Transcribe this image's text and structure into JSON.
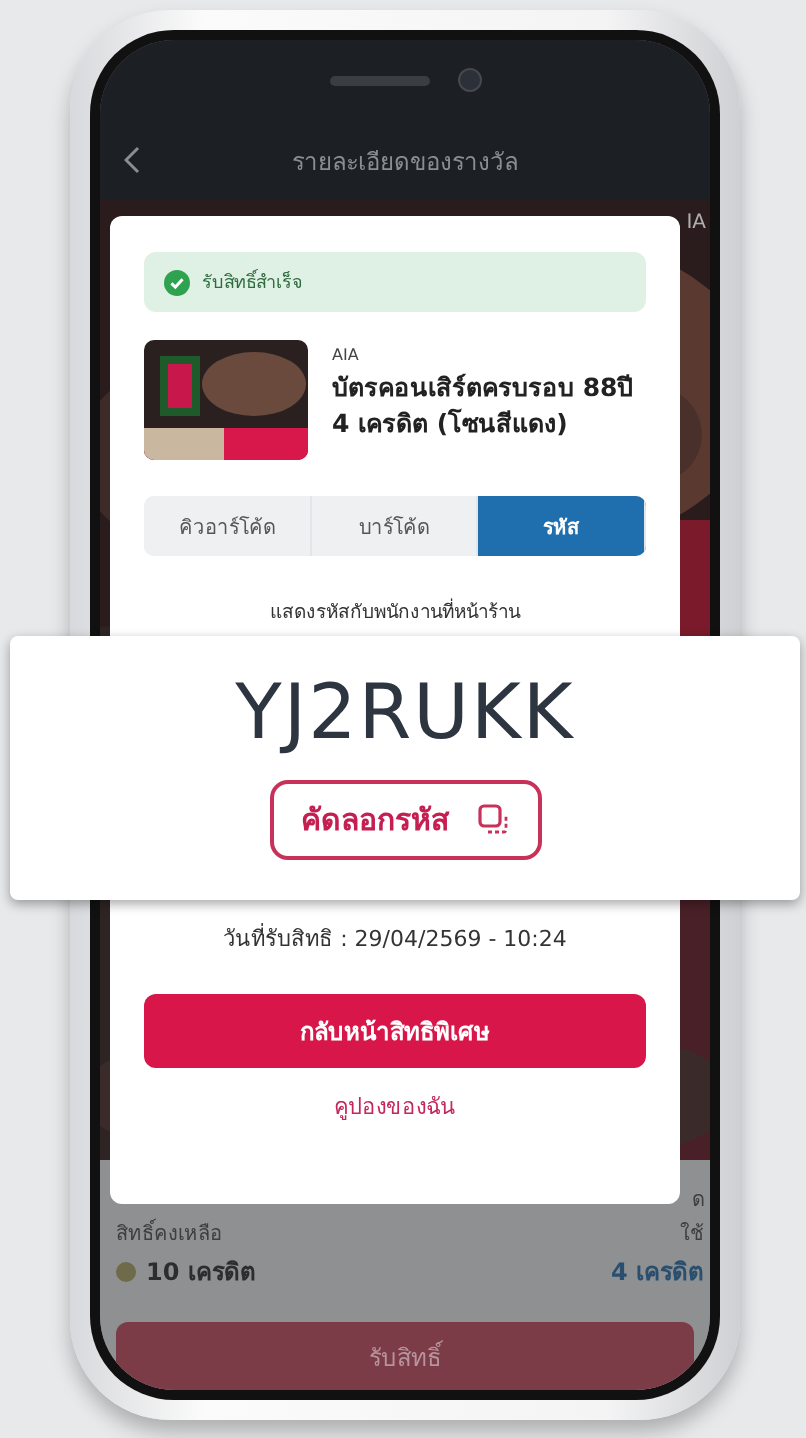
{
  "header": {
    "title": "รายละเอียดของรางวัล"
  },
  "hero": {
    "kind": "picture",
    "brand": "IA"
  },
  "summary": {
    "fragment": "ด",
    "remaining_label": "สิทธิ์คงเหลือ",
    "used_label": "ใช้",
    "remaining": "10 เครดิต",
    "used": "4 เครดิต"
  },
  "claim_button": "รับสิทธิ์",
  "dialog": {
    "alert": "รับสิทธิ์สำเร็จ",
    "brand": "AIA",
    "product": "บัตรคอนเสิร์ตครบรอบ 88ปี 4 เครดิต (โซนสีแดง)",
    "tabs": [
      {
        "label": "คิวอาร์โค้ด",
        "selected": false
      },
      {
        "label": "บาร์โค้ด",
        "selected": false
      },
      {
        "label": "รหัส",
        "selected": true
      }
    ],
    "instruction": "แสดงรหัสกับพนักงานที่หน้าร้าน",
    "date": "วันที่รับสิทธิ : 29/04/2569 - 10:24",
    "primary_button": "กลับหน้าสิทธิพิเศษ",
    "link": "คูปองของฉัน"
  },
  "code_card": {
    "code": "YJ2RUKK",
    "copy_button": "คัดลอกรหัส"
  }
}
